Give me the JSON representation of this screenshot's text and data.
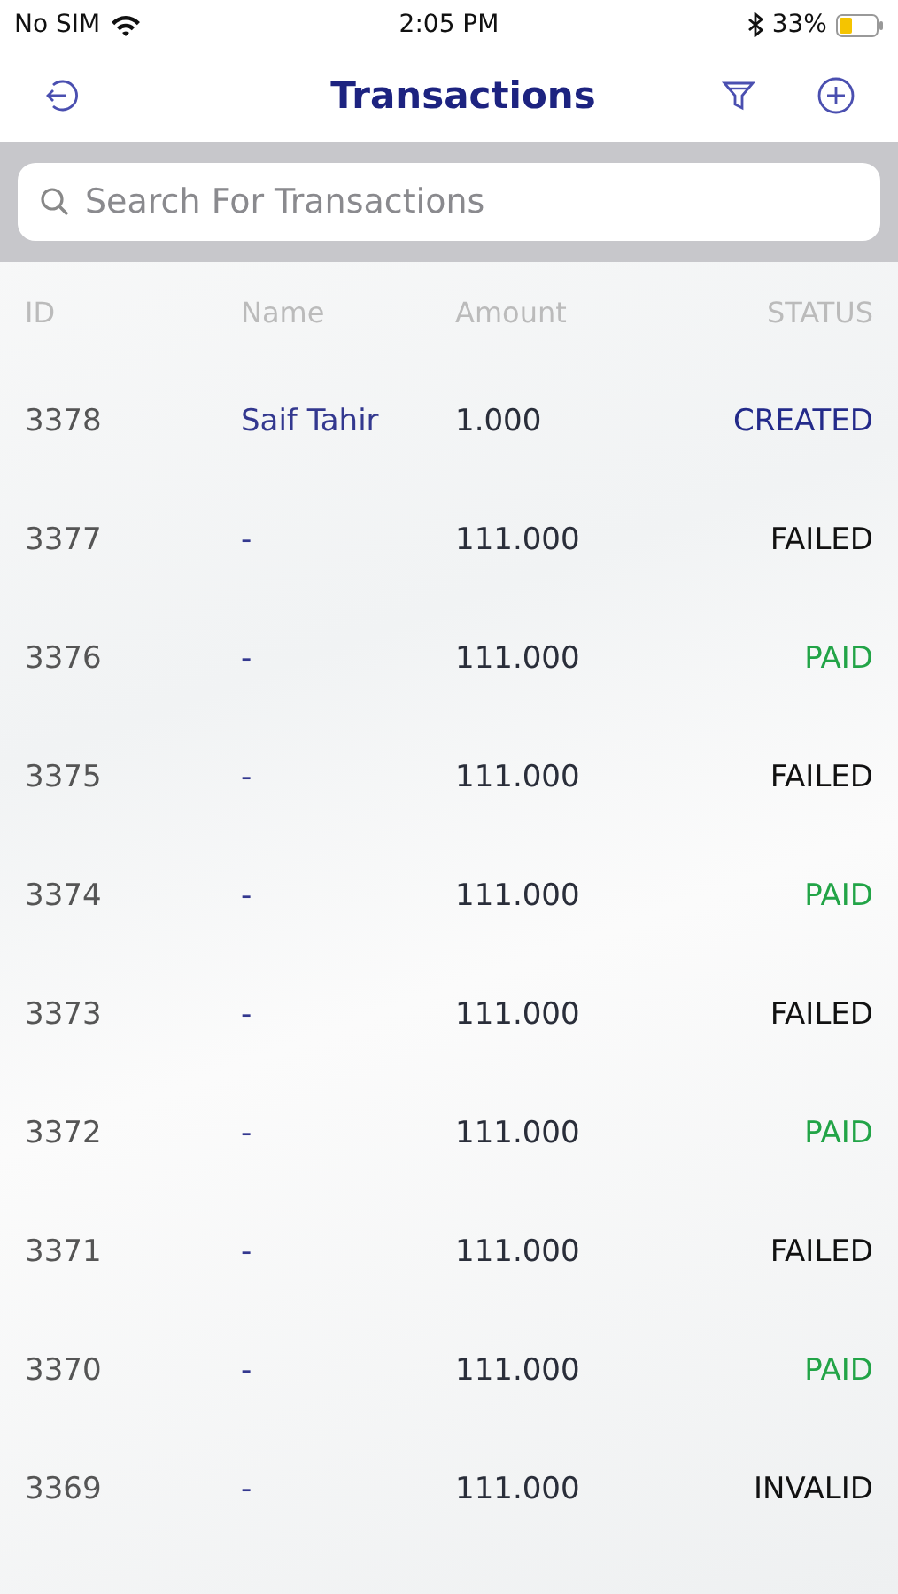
{
  "status_bar": {
    "carrier": "No SIM",
    "time": "2:05 PM",
    "battery": "33%"
  },
  "nav": {
    "title": "Transactions"
  },
  "search": {
    "placeholder": "Search For Transactions"
  },
  "table": {
    "columns": [
      "ID",
      "Name",
      "Amount",
      "STATUS"
    ],
    "rows": [
      {
        "id": "3378",
        "name": "Saif Tahir",
        "amount": "1.000",
        "status": "CREATED",
        "color": "#232a8a"
      },
      {
        "id": "3377",
        "name": "-",
        "amount": "111.000",
        "status": "FAILED",
        "color": "#111111"
      },
      {
        "id": "3376",
        "name": "-",
        "amount": "111.000",
        "status": "PAID",
        "color": "#22a447"
      },
      {
        "id": "3375",
        "name": "-",
        "amount": "111.000",
        "status": "FAILED",
        "color": "#111111"
      },
      {
        "id": "3374",
        "name": "-",
        "amount": "111.000",
        "status": "PAID",
        "color": "#22a447"
      },
      {
        "id": "3373",
        "name": "-",
        "amount": "111.000",
        "status": "FAILED",
        "color": "#111111"
      },
      {
        "id": "3372",
        "name": "-",
        "amount": "111.000",
        "status": "PAID",
        "color": "#22a447"
      },
      {
        "id": "3371",
        "name": "-",
        "amount": "111.000",
        "status": "FAILED",
        "color": "#111111"
      },
      {
        "id": "3370",
        "name": "-",
        "amount": "111.000",
        "status": "PAID",
        "color": "#22a447"
      },
      {
        "id": "3369",
        "name": "-",
        "amount": "111.000",
        "status": "INVALID",
        "color": "#111111"
      }
    ]
  }
}
